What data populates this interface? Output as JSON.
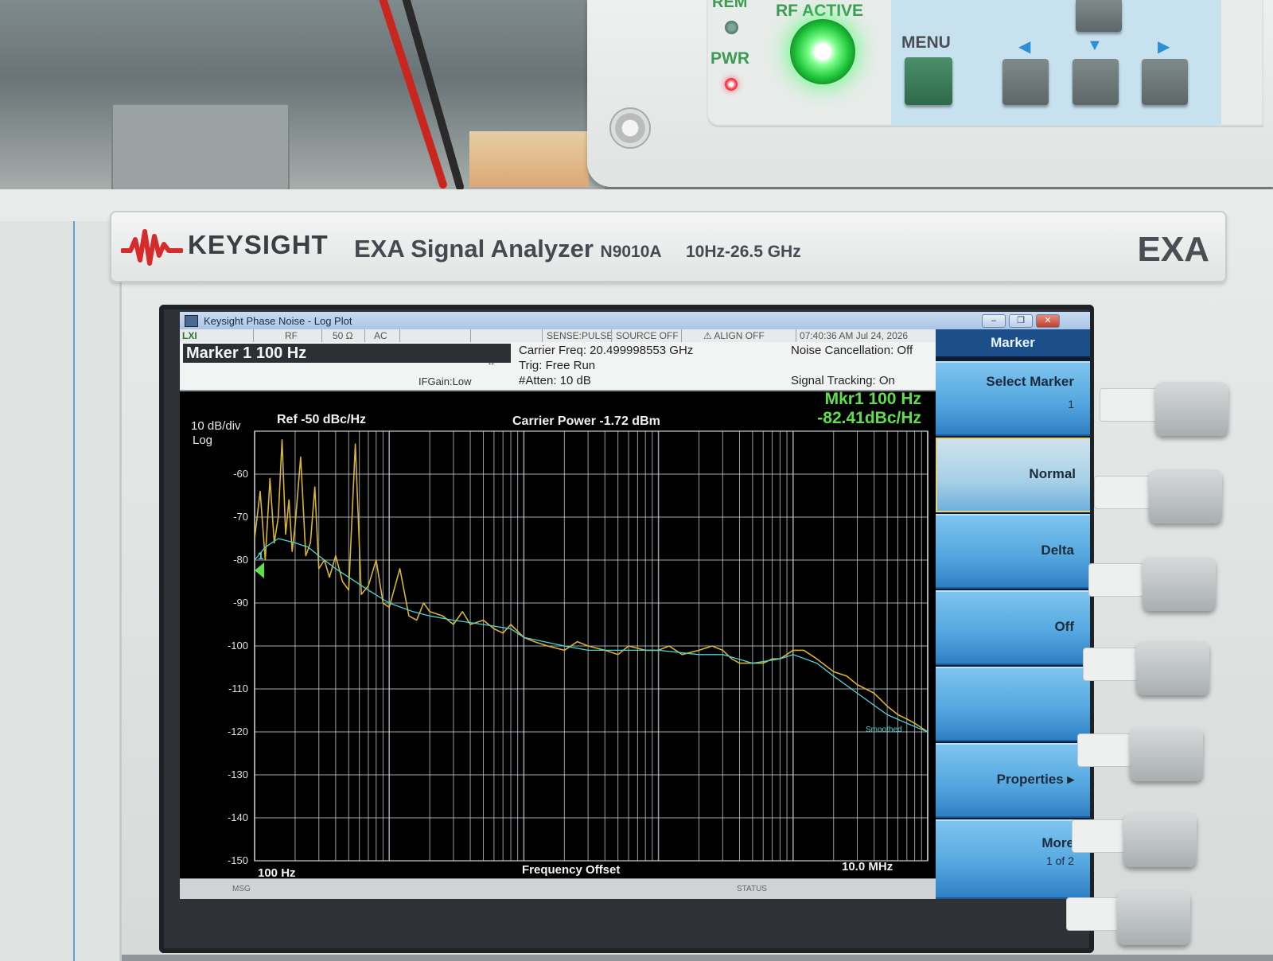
{
  "upper_instrument": {
    "labels": {
      "rem": "REM",
      "rf_active": "RF ACTIVE",
      "pwr": "PWR",
      "menu": "MENU"
    }
  },
  "brand": {
    "company": "KEYSIGHT",
    "product": "EXA Signal Analyzer",
    "model": "N9010A",
    "range": "10Hz-26.5 GHz",
    "series": "EXA"
  },
  "window": {
    "title": "Keysight Phase Noise - Log Plot",
    "buttons": [
      "–",
      "❐",
      "✕"
    ]
  },
  "status_bar": {
    "items": [
      "LXI",
      "RF",
      "50 Ω",
      "AC",
      "SENSE:PULSE",
      "SOURCE OFF",
      "⚠ ALIGN OFF",
      "07:40:36 AM Jul 24, 2026"
    ]
  },
  "info": {
    "marker_title": "Marker 1  100 Hz",
    "if_gain": "IFGain:Low",
    "carrier_freq": "Carrier Freq: 20.499998553 GHz",
    "trig": "Trig: Free Run",
    "atten": "#Atten: 10 dB",
    "noise_cancel": "Noise Cancellation: Off",
    "signal_tracking": "Signal Tracking: On"
  },
  "softkeys": {
    "menu_title": "Marker",
    "items": [
      {
        "label": "Select Marker",
        "value": "1"
      },
      {
        "label": "Normal"
      },
      {
        "label": "Delta"
      },
      {
        "label": "Off"
      },
      {
        "label": ""
      },
      {
        "label": "Properties ▸"
      },
      {
        "label": "More",
        "value": "1 of 2"
      }
    ]
  },
  "message_bar": {
    "msg": "MSG",
    "status": "STATUS"
  },
  "chart_data": {
    "type": "line",
    "scale_label": "10 dB/div",
    "scale_type": "Log",
    "ref_label": "Ref  -50 dBc/Hz",
    "carrier_power": "Carrier Power -1.72 dBm",
    "marker_readout": [
      "Mkr1 100 Hz",
      "-82.41dBc/Hz"
    ],
    "marker_label": "1",
    "xlabel": "Frequency Offset",
    "x_start_label": "100 Hz",
    "x_stop_label": "10.0 MHz",
    "x_scale": "log",
    "xlim": [
      100,
      10000000
    ],
    "ylim": [
      -150,
      -50
    ],
    "y_ticks": [
      -60,
      -70,
      -80,
      -90,
      -100,
      -110,
      -120,
      -130,
      -140,
      -150
    ],
    "smoothed_label": "Smoothed",
    "grid": true,
    "colors": {
      "trace": "#d8b432",
      "smoothed": "#4fd3d8",
      "grid": "#c9d2d6",
      "marker_text": "#5fe04a"
    },
    "series": [
      {
        "name": "Raw",
        "x": [
          100,
          110,
          120,
          130,
          140,
          150,
          160,
          170,
          180,
          190,
          200,
          220,
          240,
          260,
          280,
          300,
          330,
          360,
          400,
          450,
          500,
          560,
          620,
          700,
          800,
          900,
          1000,
          1200,
          1400,
          1600,
          1800,
          2000,
          2500,
          3000,
          3500,
          4000,
          5000,
          6000,
          7000,
          8000,
          10000,
          12000,
          15000,
          20000,
          25000,
          30000,
          40000,
          50000,
          60000,
          80000,
          100000,
          120000,
          150000,
          200000,
          250000,
          300000,
          350000,
          400000,
          500000,
          600000,
          700000,
          800000,
          1000000,
          1200000,
          1500000,
          2000000,
          2500000,
          3000000,
          4000000,
          5000000,
          6000000,
          7000000,
          8000000,
          10000000
        ],
        "y": [
          -75,
          -64,
          -80,
          -61,
          -76,
          -70,
          -52,
          -74,
          -66,
          -78,
          -72,
          -56,
          -79,
          -76,
          -63,
          -82,
          -80,
          -84,
          -79,
          -85,
          -87,
          -53,
          -88,
          -86,
          -80,
          -90,
          -91,
          -82,
          -93,
          -94,
          -90,
          -92,
          -93,
          -95,
          -92,
          -95,
          -94,
          -96,
          -97,
          -95,
          -98,
          -99,
          -100,
          -101,
          -99,
          -100,
          -101,
          -102,
          -100,
          -101,
          -101,
          -100,
          -102,
          -101,
          -100,
          -101,
          -103,
          -104,
          -104,
          -104,
          -103,
          -103,
          -101,
          -101,
          -103,
          -106,
          -107,
          -109,
          -111,
          -114,
          -116,
          -117,
          -118,
          -120
        ]
      },
      {
        "name": "Smoothed",
        "x": [
          100,
          120,
          150,
          200,
          250,
          300,
          400,
          500,
          700,
          1000,
          1500,
          2000,
          3000,
          5000,
          8000,
          10000,
          20000,
          30000,
          50000,
          100000,
          200000,
          300000,
          500000,
          800000,
          1000000,
          1500000,
          2000000,
          3000000,
          5000000,
          7000000,
          10000000
        ],
        "y": [
          -80,
          -77,
          -75,
          -76,
          -77,
          -79,
          -82,
          -84,
          -87,
          -90,
          -92,
          -93,
          -94,
          -95,
          -96,
          -98,
          -100,
          -101,
          -101,
          -101,
          -102,
          -102,
          -104,
          -103,
          -102,
          -104,
          -107,
          -111,
          -116,
          -118,
          -120
        ]
      }
    ]
  }
}
